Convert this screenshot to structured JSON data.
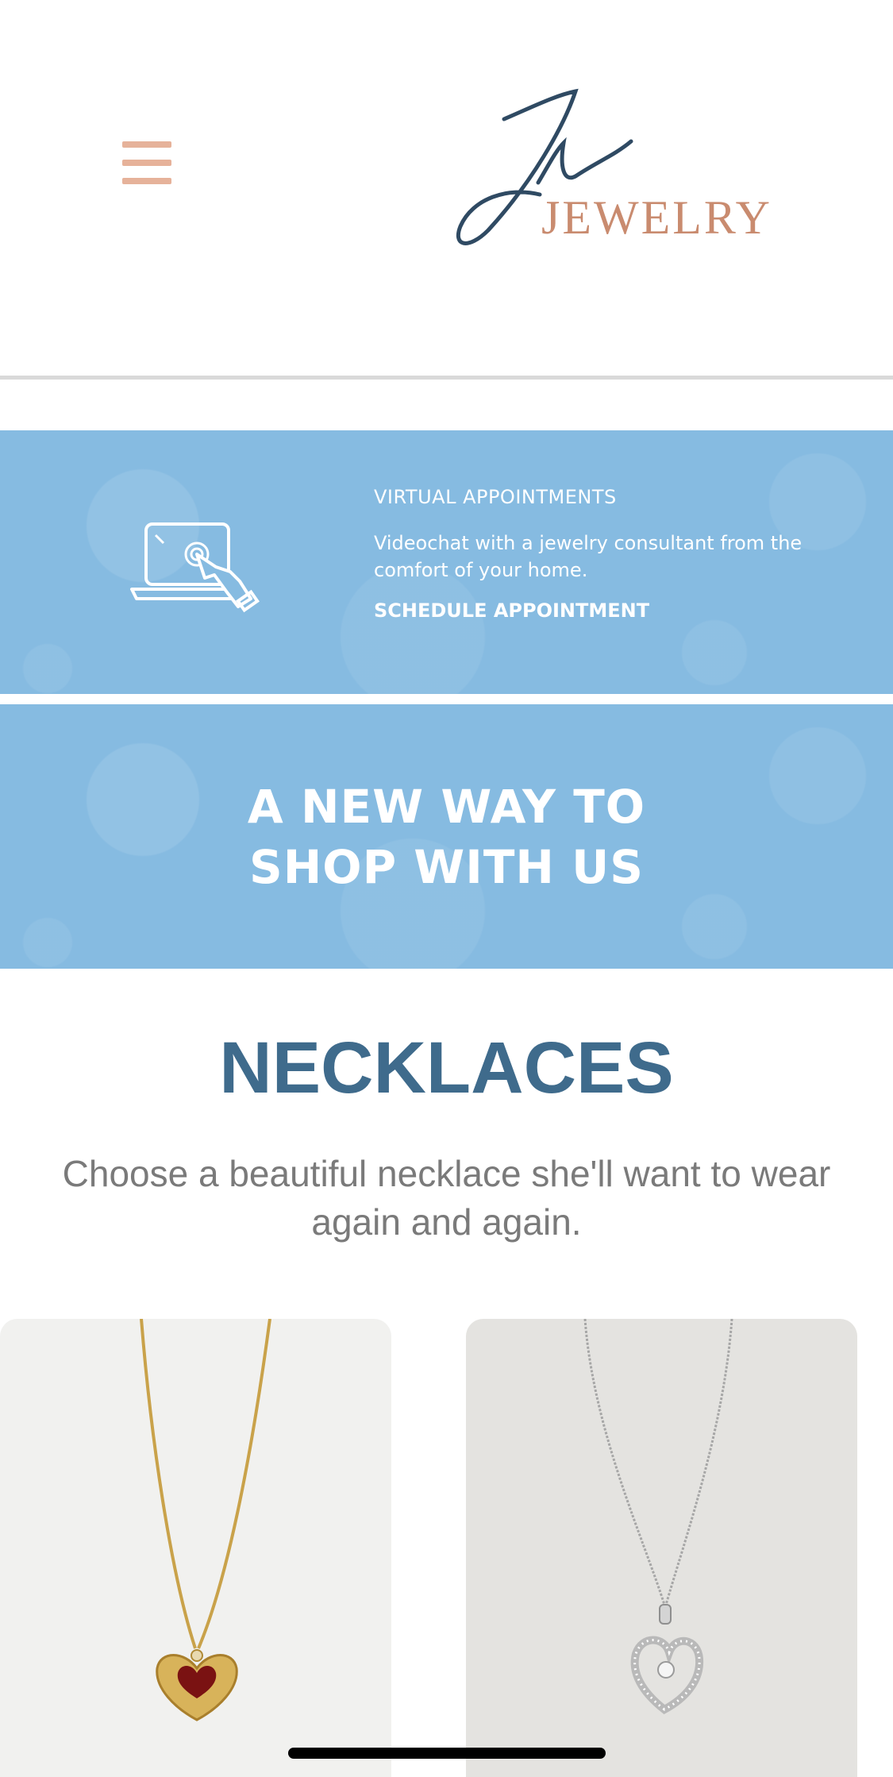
{
  "header": {
    "menu_icon": "hamburger-menu-icon",
    "logo": {
      "monogram": "JV",
      "wordmark": "JEWELRY"
    }
  },
  "appointment_banner": {
    "icon": "laptop-touch-icon",
    "title": "VIRTUAL APPOINTMENTS",
    "description": "Videochat with a jewelry consultant from the comfort of your home.",
    "link_label": "SCHEDULE APPOINTMENT"
  },
  "shop_banner": {
    "line1": "A NEW WAY TO",
    "line2": "SHOP WITH US"
  },
  "section": {
    "title": "NECKLACES",
    "description": "Choose a beautiful necklace she'll want to wear again and again."
  },
  "products": [
    {
      "image": "gold-heart-garnet-necklace"
    },
    {
      "image": "silver-heart-diamond-necklace"
    }
  ],
  "colors": {
    "banner_blue": "#86bbe1",
    "heading_blue": "#3f6b8c",
    "accent_peach": "#e6b29a",
    "logo_navy": "#2f4a63"
  }
}
